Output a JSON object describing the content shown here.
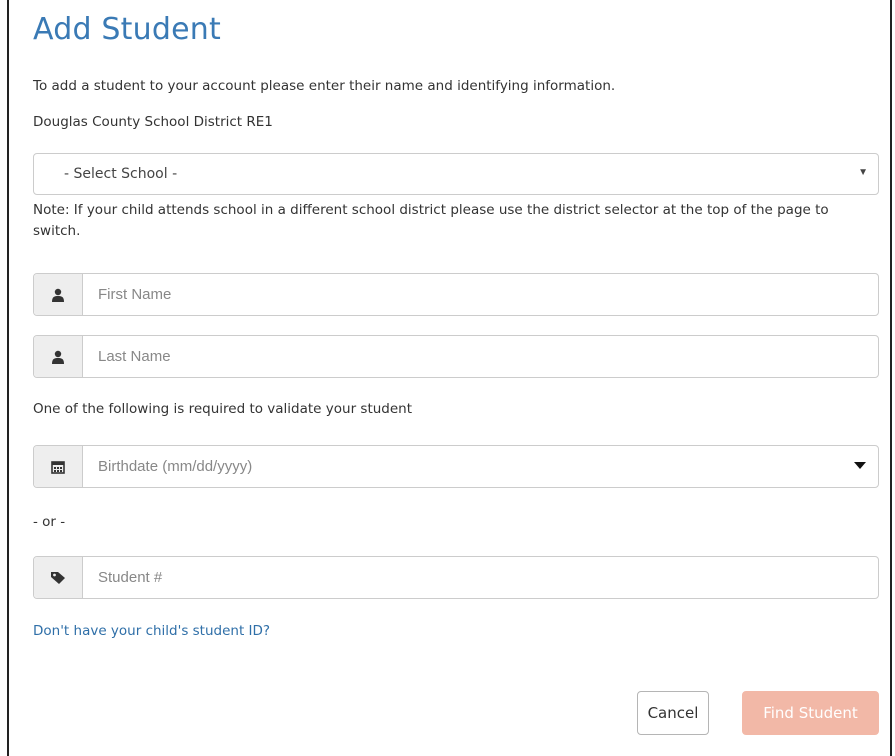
{
  "page": {
    "title": "Add Student",
    "intro": "To add a student to your account please enter their name and identifying information.",
    "district": "Douglas County School District RE1",
    "note": "Note: If your child attends school in a different school district please use the district selector at the top of the page to switch.",
    "required_text": "One of the following is required to validate your student",
    "or_text": "- or -",
    "help_link": "Don't have your child's student ID?"
  },
  "school_select": {
    "selected": "- Select School -"
  },
  "fields": {
    "first_name": {
      "placeholder": "First Name",
      "icon": "user-icon"
    },
    "last_name": {
      "placeholder": "Last Name",
      "icon": "user-icon"
    },
    "birthdate": {
      "placeholder": "Birthdate (mm/dd/yyyy)",
      "icon": "calendar-icon"
    },
    "student_number": {
      "placeholder": "Student #",
      "icon": "tag-icon"
    }
  },
  "buttons": {
    "cancel": "Cancel",
    "find_student": "Find Student"
  },
  "colors": {
    "title": "#3a7ab5",
    "link": "#2f6fa8",
    "primary_disabled": "#f2b8a7"
  }
}
